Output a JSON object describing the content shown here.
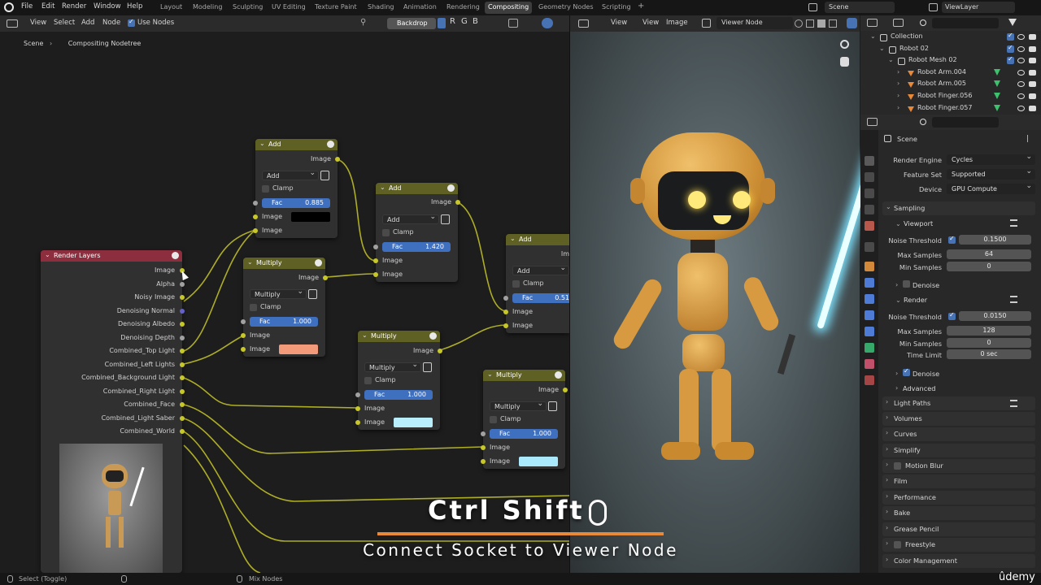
{
  "topbar": {
    "menus": [
      "File",
      "Edit",
      "Render",
      "Window",
      "Help"
    ],
    "workspaces": [
      "Layout",
      "Modeling",
      "Sculpting",
      "UV Editing",
      "Texture Paint",
      "Shading",
      "Animation",
      "Rendering",
      "Compositing",
      "Geometry Nodes",
      "Scripting"
    ],
    "active_workspace": "Compositing",
    "add_tab": "+",
    "scene_name": "Scene",
    "view_layer": "ViewLayer"
  },
  "node_header": {
    "menus": [
      "View",
      "Select",
      "Add",
      "Node"
    ],
    "use_nodes_label": "Use Nodes",
    "backdrop_label": "Backdrop",
    "channels": [
      "R",
      "G",
      "B"
    ]
  },
  "breadcrumb": {
    "scene": "Scene",
    "tree": "Compositing Nodetree"
  },
  "nodes": {
    "add1": {
      "title": "Add",
      "out": "Image",
      "op": "Add",
      "clamp": "Clamp",
      "fac_label": "Fac",
      "fac": "0.885",
      "in1": "Image",
      "in2": "Image",
      "swatch": "#000000"
    },
    "add2": {
      "title": "Add",
      "out": "Image",
      "op": "Add",
      "clamp": "Clamp",
      "fac_label": "Fac",
      "fac": "1.420",
      "in1": "Image",
      "in2": "Image"
    },
    "add3": {
      "title": "Add",
      "out": "Im",
      "op": "Add",
      "clamp": "Clamp",
      "fac_label": "Fac",
      "fac": "0.51",
      "in1": "Image",
      "in2": "Image"
    },
    "mul1": {
      "title": "Multiply",
      "out": "Image",
      "op": "Multiply",
      "clamp": "Clamp",
      "fac_label": "Fac",
      "fac": "1.000",
      "in1": "Image",
      "in2": "Image",
      "swatch": "#f39a7a"
    },
    "mul2": {
      "title": "Multiply",
      "out": "Image",
      "op": "Multiply",
      "clamp": "Clamp",
      "fac_label": "Fac",
      "fac": "1.000",
      "in1": "Image",
      "in2": "Image",
      "swatch": "#b9eefc"
    },
    "mul3": {
      "title": "Multiply",
      "out": "Image",
      "op": "Multiply",
      "clamp": "Clamp",
      "fac_label": "Fac",
      "fac": "1.000",
      "in1": "Image",
      "in2": "Image",
      "swatch": "#a9e9fb"
    },
    "render_layers": {
      "title": "Render Layers",
      "outputs": [
        "Image",
        "Alpha",
        "Noisy Image",
        "Denoising Normal",
        "Denoising Albedo",
        "Denoising Depth",
        "Combined_Top Light",
        "Combined_Left Lights",
        "Combined_Background Light",
        "Combined_Right Light",
        "Combined_Face",
        "Combined_Light Saber",
        "Combined_World"
      ]
    }
  },
  "viewer_header": {
    "menus": [
      "View",
      "View",
      "Image"
    ],
    "node_name": "Viewer Node"
  },
  "overlay": {
    "keys": "Ctrl Shift",
    "caption": "Connect Socket to Viewer Node",
    "accent": "#e8893a"
  },
  "outliner": {
    "items": [
      {
        "label": "Collection",
        "level": 0
      },
      {
        "label": "Robot 02",
        "level": 1
      },
      {
        "label": "Robot Mesh 02",
        "level": 2
      },
      {
        "label": "Robot Arm.004",
        "level": 3
      },
      {
        "label": "Robot Arm.005",
        "level": 3
      },
      {
        "label": "Robot Finger.056",
        "level": 3
      },
      {
        "label": "Robot Finger.057",
        "level": 3
      }
    ]
  },
  "properties": {
    "context": "Scene",
    "render_engine_label": "Render Engine",
    "render_engine": "Cycles",
    "feature_set_label": "Feature Set",
    "feature_set": "Supported",
    "device_label": "Device",
    "device": "GPU Compute",
    "sampling": "Sampling",
    "viewport": "Viewport",
    "vp_noise_label": "Noise Threshold",
    "vp_noise": "0.1500",
    "vp_max_label": "Max Samples",
    "vp_max": "64",
    "vp_min_label": "Min Samples",
    "vp_min": "0",
    "vp_denoise": "Denoise",
    "render": "Render",
    "r_noise_label": "Noise Threshold",
    "r_noise": "0.0150",
    "r_max_label": "Max Samples",
    "r_max": "128",
    "r_min_label": "Min Samples",
    "r_min": "0",
    "r_time_label": "Time Limit",
    "r_time": "0 sec",
    "r_denoise": "Denoise",
    "advanced": "Advanced",
    "panels": [
      "Light Paths",
      "Volumes",
      "Curves",
      "Simplify",
      "Motion Blur",
      "Film",
      "Performance",
      "Bake",
      "Grease Pencil",
      "Freestyle",
      "Color Management"
    ]
  },
  "status": {
    "left": "Select (Toggle)",
    "middle": "Mix Nodes"
  },
  "watermark": "ûdemy"
}
